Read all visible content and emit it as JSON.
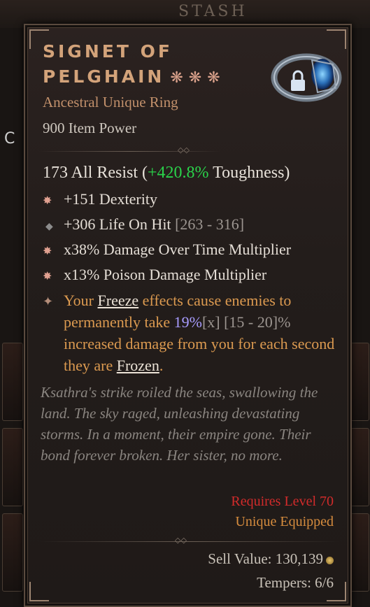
{
  "background": {
    "stash_title": "STASH",
    "side_left_char": "C"
  },
  "item": {
    "name_line1": "SIGNET OF",
    "name_line2": "PELGHAIN",
    "greater_affix_stars": [
      "❋",
      "❋",
      "❋"
    ],
    "type": "Ancestral Unique Ring",
    "item_power": "900 Item Power",
    "resist_main": "173 All Resist (",
    "resist_toughness": "+420.8%",
    "resist_suffix": " Toughness)",
    "affixes": [
      {
        "bullet": "✸",
        "text": "+151 Dexterity",
        "range": ""
      },
      {
        "bullet": "◆",
        "text": "+306 Life On Hit",
        "range": " [263 - 316]"
      },
      {
        "bullet": "✸",
        "text": "x38% Damage Over Time Multiplier",
        "range": ""
      },
      {
        "bullet": "✸",
        "text": "x13% Poison Damage Multiplier",
        "range": ""
      }
    ],
    "unique_bullet": "✦",
    "unique_power": {
      "p1": "Your ",
      "freeze": "Freeze",
      "p2": " effects cause enemies to permanently take ",
      "value": "19%",
      "x": "[x]",
      "range": " [15 - 20]%",
      "p3": " increased damage from you for each second they are ",
      "frozen": "Frozen",
      "p4": "."
    },
    "lore": "Ksathra's strike roiled the seas, swallowing the land. The sky raged, unleashing devastating storms. In a moment, their empire gone. Their bond forever broken. Her sister, no more.",
    "requires_level": "Requires Level 70",
    "unique_equipped": "Unique Equipped",
    "sell_value": "Sell Value: 130,139",
    "tempers": "Tempers: 6/6"
  },
  "colors": {
    "name": "#d3a37a",
    "toughness_green": "#2ad24a",
    "unique_orange": "#dc9a50",
    "requirement_red": "#d22b2b"
  }
}
